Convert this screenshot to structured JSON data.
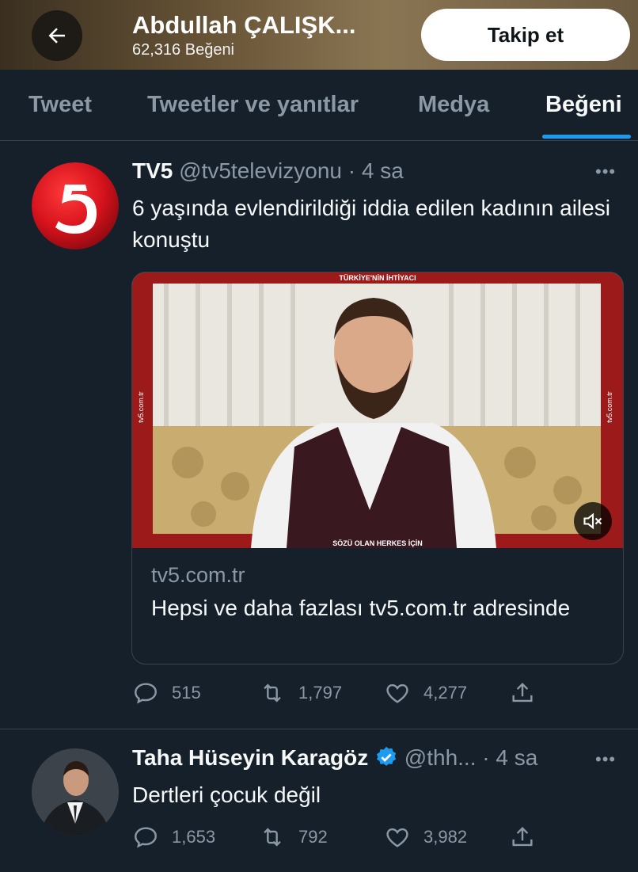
{
  "header": {
    "name": "Abdullah ÇALIŞK...",
    "subtitle": "62,316 Beğeni",
    "follow_label": "Takip et"
  },
  "tabs": [
    {
      "label": "Tweet"
    },
    {
      "label": "Tweetler ve yanıtlar"
    },
    {
      "label": "Medya"
    },
    {
      "label": "Beğeni",
      "active": true
    }
  ],
  "tweets": [
    {
      "name": "TV5",
      "handle": "@tv5televizyonu",
      "time": "· 4 sa",
      "text": "6 yaşında evlendirildiği iddia edilen kadının ailesi konuştu",
      "card": {
        "media_top_text": "TÜRKİYE'NİN İHTİYACI",
        "media_bottom_text": "SÖZÜ OLAN HERKES İÇİN",
        "media_side_text": "tv5.com.tr",
        "domain": "tv5.com.tr",
        "title": "Hepsi ve daha fazlası tv5.com.tr adresinde"
      },
      "replies": "515",
      "retweets": "1,797",
      "likes": "4,277"
    },
    {
      "name": "Taha Hüseyin Karagöz",
      "handle": "@thh...",
      "time": "· 4 sa",
      "verified": true,
      "text": "Dertleri çocuk değil",
      "replies": "1,653",
      "retweets": "792",
      "likes": "3,982"
    }
  ],
  "colors": {
    "background": "#15202b",
    "accent": "#1d9bf0",
    "muted": "#8b98a5",
    "tv5_red": "#d6121c"
  },
  "icons": [
    "back-arrow-icon",
    "more-icon",
    "reply-icon",
    "retweet-icon",
    "like-icon",
    "share-icon",
    "mute-icon",
    "verified-icon"
  ]
}
